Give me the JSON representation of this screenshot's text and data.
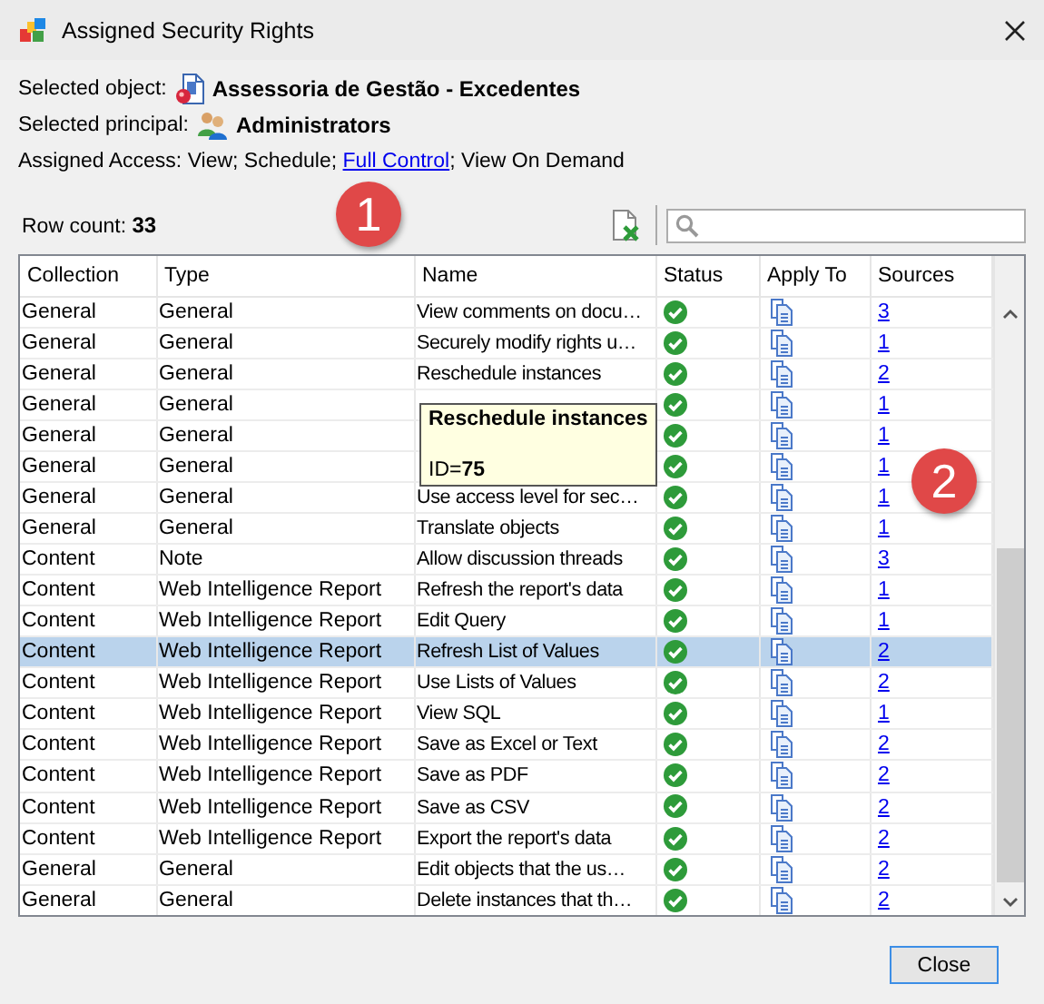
{
  "window": {
    "title": "Assigned Security Rights"
  },
  "info": {
    "object_label": "Selected object:",
    "object": "Assessoria de Gestão - Excedentes",
    "principal_label": "Selected principal:",
    "principal": "Administrators",
    "access_parts": [
      {
        "kind": "text",
        "text": "Assigned Access: View; Schedule; "
      },
      {
        "kind": "link",
        "text": "Full Control"
      },
      {
        "kind": "text",
        "text": "; View On Demand"
      }
    ]
  },
  "row_count": {
    "label": "Row count:",
    "value": "33"
  },
  "table": {
    "columns": [
      "Collection",
      "Type",
      "Name",
      "Status",
      "Apply To",
      "Sources"
    ],
    "rows": [
      {
        "collection": "General",
        "type": "General",
        "name": "View comments on docu…",
        "granted": true,
        "sources": "3",
        "selected": false
      },
      {
        "collection": "General",
        "type": "General",
        "name": "Securely modify rights u…",
        "granted": true,
        "sources": "1",
        "selected": false
      },
      {
        "collection": "General",
        "type": "General",
        "name": "Reschedule instances",
        "granted": true,
        "sources": "2",
        "selected": false
      },
      {
        "collection": "General",
        "type": "General",
        "granted": true,
        "sources": "1",
        "selected": false
      },
      {
        "collection": "General",
        "type": "General",
        "granted": true,
        "sources": "1",
        "selected": false
      },
      {
        "collection": "General",
        "type": "General",
        "granted": true,
        "sources": "1",
        "selected": false
      },
      {
        "collection": "General",
        "type": "General",
        "name": "Use access level for sec…",
        "granted": true,
        "sources": "1",
        "selected": false
      },
      {
        "collection": "General",
        "type": "General",
        "name": "Translate objects",
        "granted": true,
        "sources": "1",
        "selected": false
      },
      {
        "collection": "Content",
        "type": "Note",
        "name": "Allow discussion threads",
        "granted": true,
        "sources": "3",
        "selected": false
      },
      {
        "collection": "Content",
        "type": "Web Intelligence Report",
        "name": "Refresh the report's data",
        "granted": true,
        "sources": "1",
        "selected": false
      },
      {
        "collection": "Content",
        "type": "Web Intelligence Report",
        "name": "Edit Query",
        "granted": true,
        "sources": "1",
        "selected": false
      },
      {
        "collection": "Content",
        "type": "Web Intelligence Report",
        "name": "Refresh List of Values",
        "granted": true,
        "sources": "2",
        "selected": true
      },
      {
        "collection": "Content",
        "type": "Web Intelligence Report",
        "name": "Use Lists of Values",
        "granted": true,
        "sources": "2",
        "selected": false
      },
      {
        "collection": "Content",
        "type": "Web Intelligence Report",
        "name": "View SQL",
        "granted": true,
        "sources": "1",
        "selected": false
      },
      {
        "collection": "Content",
        "type": "Web Intelligence Report",
        "name": "Save as Excel or Text",
        "granted": true,
        "sources": "2",
        "selected": false
      },
      {
        "collection": "Content",
        "type": "Web Intelligence Report",
        "name": "Save as PDF",
        "granted": true,
        "sources": "2",
        "selected": false
      },
      {
        "collection": "Content",
        "type": "Web Intelligence Report",
        "name": "Save as CSV",
        "granted": true,
        "sources": "2",
        "selected": false
      },
      {
        "collection": "Content",
        "type": "Web Intelligence Report",
        "name": "Export the report's data",
        "granted": true,
        "sources": "2",
        "selected": false
      },
      {
        "collection": "General",
        "type": "General",
        "name": "Edit objects that the us…",
        "granted": true,
        "sources": "2",
        "selected": false
      },
      {
        "collection": "General",
        "type": "General",
        "name": "Delete instances that th…",
        "granted": true,
        "sources": "2",
        "selected": false
      }
    ]
  },
  "tooltip": {
    "title": "Reschedule instances",
    "detail": "ID=**75**"
  },
  "callouts": [
    {
      "number": "1"
    },
    {
      "number": "2"
    }
  ],
  "buttons": [
    {
      "label": "Close"
    }
  ]
}
